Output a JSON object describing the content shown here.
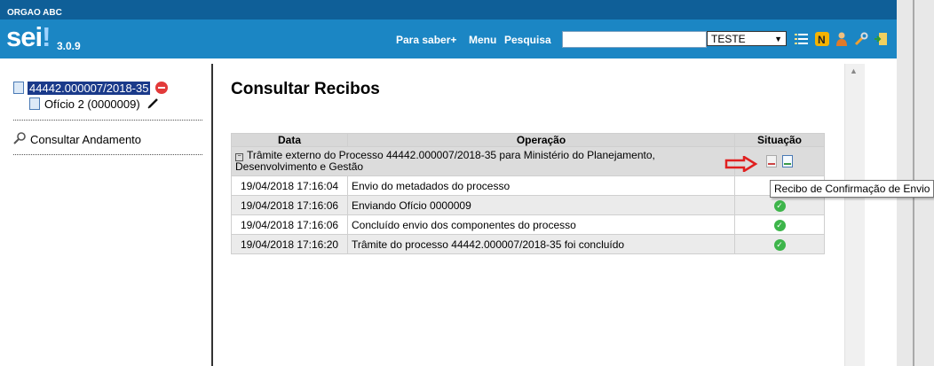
{
  "header": {
    "org_name": "ORGAO ABC",
    "logo_text": "sei",
    "logo_bang": "!",
    "version": "3.0.9",
    "links": {
      "saber_mais": "Para saber+",
      "menu": "Menu",
      "pesquisa": "Pesquisa"
    },
    "search": {
      "value": "",
      "placeholder": ""
    },
    "unit_select": "TESTE",
    "icons": [
      "list-icon",
      "notes-icon",
      "user-icon",
      "tools-icon",
      "exit-icon"
    ]
  },
  "tree": {
    "process_number": "44442.000007/2018-35",
    "document_label": "Ofício 2 (0000009)",
    "andamento_label": "Consultar Andamento"
  },
  "main": {
    "title": "Consultar Recibos",
    "table": {
      "headers": [
        "Data",
        "Operação",
        "Situação"
      ],
      "group": "Trâmite externo do Processo 44442.000007/2018-35 para Ministério do Planejamento, Desenvolvimento e Gestão",
      "rows": [
        {
          "date": "19/04/2018 17:16:04",
          "operation": "Envio do metadados do processo",
          "status": ""
        },
        {
          "date": "19/04/2018 17:16:06",
          "operation": "Enviando Ofício 0000009",
          "status": "ok"
        },
        {
          "date": "19/04/2018 17:16:06",
          "operation": "Concluído envio dos componentes do processo",
          "status": "ok"
        },
        {
          "date": "19/04/2018 17:16:20",
          "operation": "Trâmite do processo 44442.000007/2018-35 foi concluído",
          "status": "ok"
        }
      ]
    },
    "tooltip": "Recibo de Confirmação de Envio"
  },
  "colors": {
    "header_blue": "#1b86c4",
    "org_bar": "#0f5f98",
    "selected_bg": "#1a3a8a",
    "check_green": "#3db54a",
    "arrow_red": "#e02020"
  }
}
